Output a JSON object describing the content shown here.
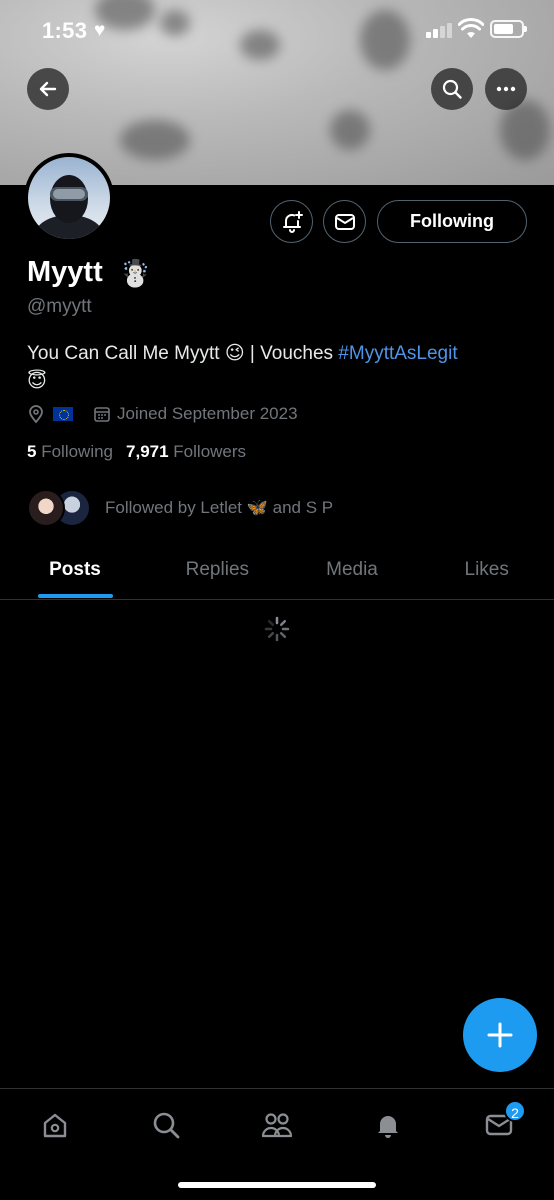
{
  "status_bar": {
    "time": "1:53",
    "heart": "♥"
  },
  "header": {
    "back_icon": "arrow-left-icon",
    "search_icon": "search-icon",
    "more_icon": "more-horizontal-icon"
  },
  "profile": {
    "display_name": "Myytt",
    "name_emoji": "☃️",
    "handle": "@myytt",
    "bio_text": "You Can Call Me Myytt 😉 | Vouches ",
    "bio_hashtag": "#MyyttAsLegit",
    "bio_emoji": "😇",
    "location_flag": "EU flag",
    "joined": "Joined September 2023",
    "following_count": "5",
    "following_label": "Following",
    "followers_count": "7,971",
    "followers_label": "Followers",
    "followed_by": "Followed by Letlet 🦋 and S P"
  },
  "actions": {
    "following_button": "Following"
  },
  "tabs": [
    {
      "label": "Posts",
      "active": true
    },
    {
      "label": "Replies",
      "active": false
    },
    {
      "label": "Media",
      "active": false
    },
    {
      "label": "Likes",
      "active": false
    }
  ],
  "bottom_nav": {
    "items": [
      "home-icon",
      "search-icon",
      "communities-icon",
      "notifications-icon",
      "messages-icon"
    ],
    "messages_badge": "2"
  },
  "colors": {
    "accent": "#1d9bf0",
    "hashtag": "#4e95e8",
    "muted": "#71767b",
    "background": "#000000"
  }
}
